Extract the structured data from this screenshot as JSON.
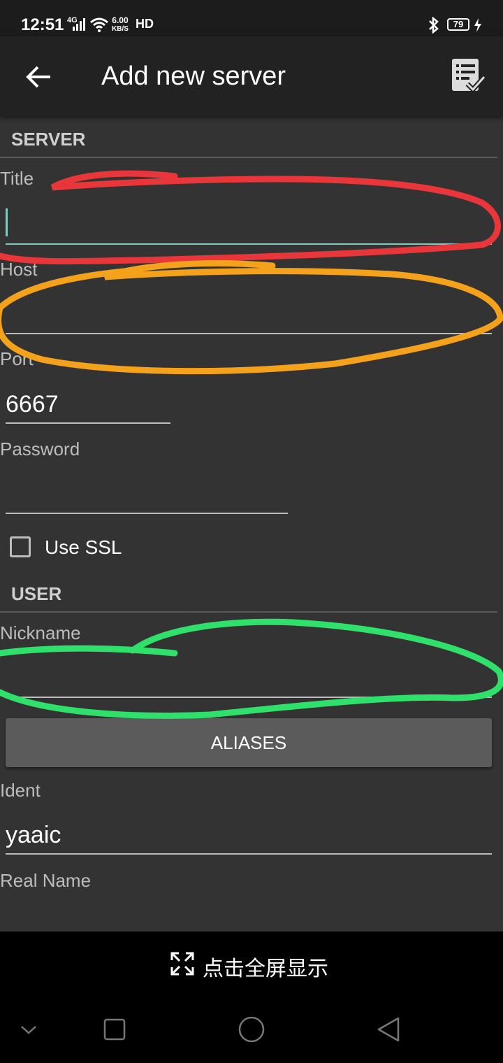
{
  "status_bar": {
    "time": "12:51",
    "network": "4G",
    "speed_value": "6.00",
    "speed_unit": "KB/S",
    "hd": "HD",
    "battery": "79",
    "icons": [
      "signal-icon",
      "wifi-icon",
      "bluetooth-icon",
      "battery-icon",
      "charging-icon"
    ]
  },
  "app_bar": {
    "title": "Add new server",
    "icons": [
      "back-arrow-icon",
      "save-checklist-icon"
    ]
  },
  "server_section": {
    "header": "SERVER",
    "title_label": "Title",
    "title_value": "",
    "host_label": "Host",
    "host_value": "",
    "port_label": "Port",
    "port_value": "6667",
    "password_label": "Password",
    "password_value": "",
    "ssl_label": "Use SSL",
    "ssl_checked": false
  },
  "user_section": {
    "header": "USER",
    "nickname_label": "Nickname",
    "nickname_value": "",
    "aliases_button": "ALIASES",
    "ident_label": "Ident",
    "ident_value": "yaaic",
    "realname_label": "Real Name"
  },
  "fullscreen_bar": {
    "text": "点击全屏显示",
    "icon": "fullscreen-expand-icon"
  },
  "nav_bar": {
    "icons": [
      "chevron-down-icon",
      "recents-square-icon",
      "home-circle-icon",
      "back-triangle-icon"
    ]
  },
  "colors": {
    "background": "#333333",
    "app_bar": "#222222",
    "focus_accent": "#80cbc4",
    "annotation_red": "#e8363a",
    "annotation_orange": "#f4a11c",
    "annotation_green": "#2fe06a"
  }
}
